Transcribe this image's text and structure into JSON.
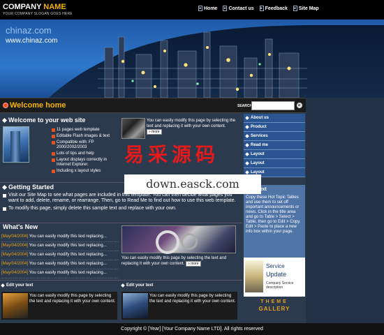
{
  "header": {
    "company_prefix": "COMPANY ",
    "company_name": "NAME",
    "slogan": "YOUR COMPANY SLOGAN GOES HERE",
    "nav": [
      {
        "label": "Home"
      },
      {
        "label": "Contact us"
      },
      {
        "label": "Feedback"
      },
      {
        "label": "Site Map"
      }
    ]
  },
  "banner": {
    "domain1": "chinaz.com",
    "domain2": "www.chinaz.com"
  },
  "welcome_bar": {
    "title": "Welcome home",
    "search_label": "SEARCH",
    "search_value": ""
  },
  "welcome_site": {
    "title": "Welcome to your web site",
    "features": [
      "11 pages web template",
      "Editable Flash images & text",
      "Compatible with: FP 2000/2002/2003",
      "Lots of tips and help",
      "Layout displays correctly in Internet Explorer.",
      "Including x layout styles"
    ]
  },
  "promo_top": {
    "text": "You can easily modify this page by selecting the text and replacing it with your own content.",
    "more": "more"
  },
  "getting_started": {
    "title": "Getting Started",
    "p1": "Visit our Site Map to see what pages are included in this template. You can then decide what pages you want to add, delete, rename, or rearrange. Then, go to Read Me to find out how to use this web template.",
    "p2": "To modify this page, simply delete this sample text and replace with your own."
  },
  "whats_new": {
    "title": "What's New",
    "items": [
      {
        "date": "[May/04/2004]",
        "text": "You can easily modify this text replacing..."
      },
      {
        "date": "[May/04/2004]",
        "text": "You can easily modify this text replacing..."
      },
      {
        "date": "[May/04/2004]",
        "text": "You can easily modify this text replacing..."
      },
      {
        "date": "[May/04/2004]",
        "text": "You can easily modify this text replacing..."
      },
      {
        "date": "[May/04/2004]",
        "text": "You can easily modify this text replacing..."
      }
    ]
  },
  "promo_mid": {
    "text": "You can easily modify this page by selecting the text and replacing it with your own content.",
    "more": "more"
  },
  "edit_boxes": [
    {
      "title": "Edit your text",
      "text": "You can easily modify this page by selecting the text and replacing it with your own content."
    },
    {
      "title": "Edit your text",
      "text": "You can easily modify this page by selecting the text and replacing it with your own content."
    }
  ],
  "sidebar": {
    "menu": [
      {
        "label": "About us"
      },
      {
        "label": "Product"
      },
      {
        "label": "Services"
      },
      {
        "label": "Read me"
      },
      {
        "label": "Layout"
      },
      {
        "label": "Layout"
      },
      {
        "label": "Layout"
      }
    ],
    "hot_topic_title": "Your text",
    "hot_topic_body": "Copy these Hot Topic Tables and use them to set off important announcements or news. Click in the title area and go to Table > Select > Table, then go to Edit > Copy. Edit > Paste to place a new info box within your page.",
    "service_t1": "Service",
    "service_t2": "Update",
    "service_t3": "Company Service description",
    "gallery_l1": "THEME",
    "gallery_l2": "GALLERY"
  },
  "watermark": {
    "cn": "易采源码",
    "en": "down.easck.com"
  },
  "footer": {
    "text": "Copyright © [Year] [Your Company Name LTD]. All rights reserved"
  },
  "colors": {
    "accent": "#f4b400",
    "date": "#e8a21b",
    "bullet": "#e8531b",
    "sidebar_menu": "#2b5590",
    "watermark_red": "#e51a1a"
  }
}
